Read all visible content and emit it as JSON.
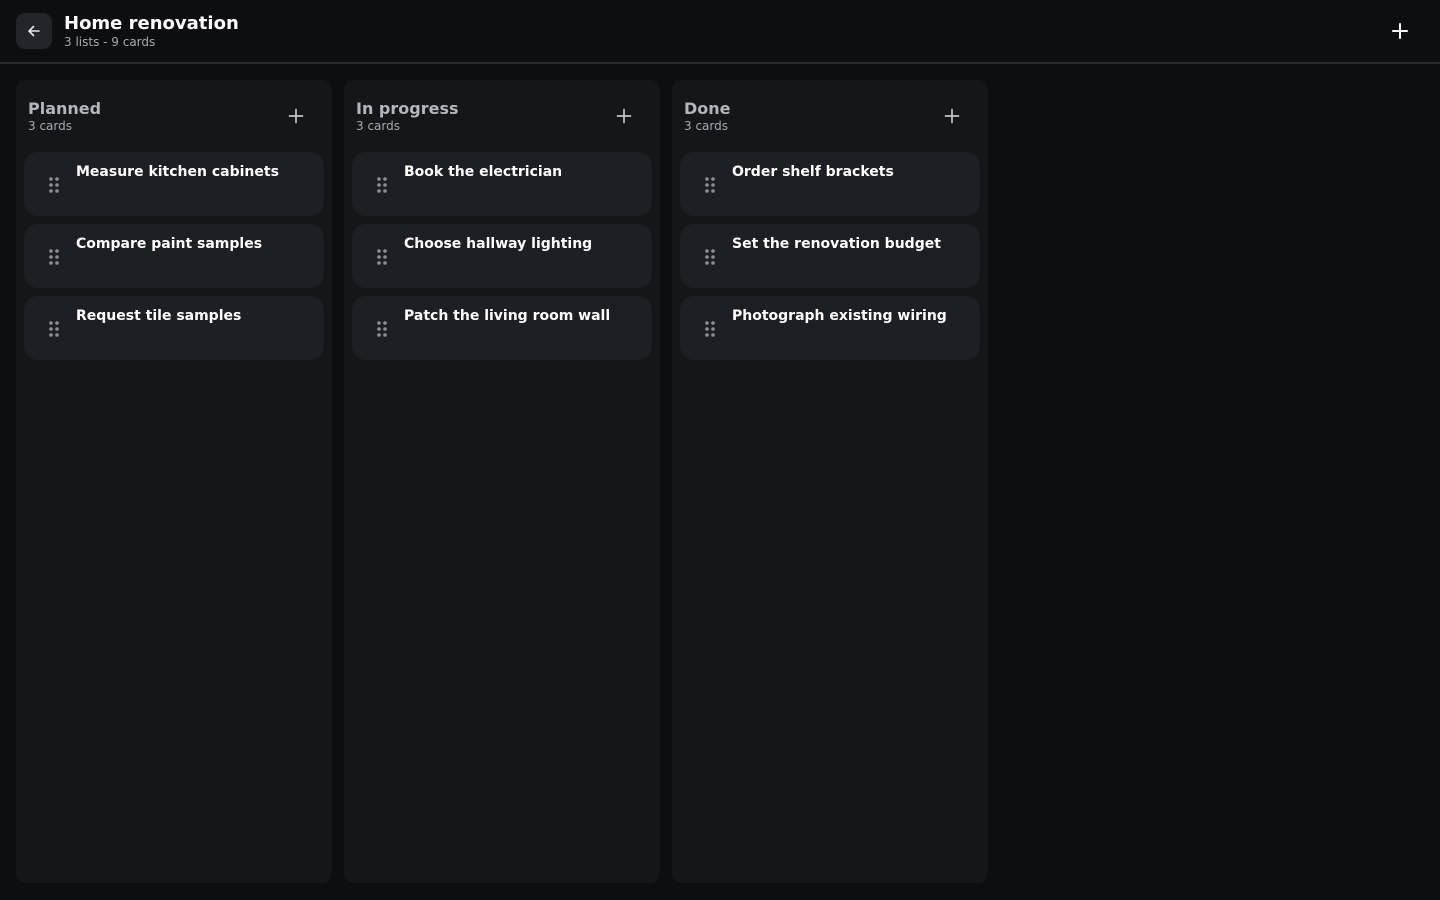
{
  "header": {
    "title": "Home renovation",
    "subtitle": "3 lists - 9 cards",
    "back_icon": "arrow-left-icon",
    "add_icon": "plus-icon"
  },
  "colors": {
    "background": "#0d0e11",
    "column": "#15161a",
    "card": "#1e1f24",
    "text_primary": "#ffffff",
    "text_muted": "#a7a9b0"
  },
  "columns": [
    {
      "title": "Planned",
      "count": "3 cards",
      "cards": [
        {
          "title": "Measure kitchen cabinets"
        },
        {
          "title": "Compare paint samples"
        },
        {
          "title": "Request tile samples"
        }
      ]
    },
    {
      "title": "In progress",
      "count": "3 cards",
      "cards": [
        {
          "title": "Book the electrician"
        },
        {
          "title": "Choose hallway lighting"
        },
        {
          "title": "Patch the living room wall"
        }
      ]
    },
    {
      "title": "Done",
      "count": "3 cards",
      "cards": [
        {
          "title": "Order shelf brackets"
        },
        {
          "title": "Set the renovation budget"
        },
        {
          "title": "Photograph existing wiring"
        }
      ]
    }
  ]
}
